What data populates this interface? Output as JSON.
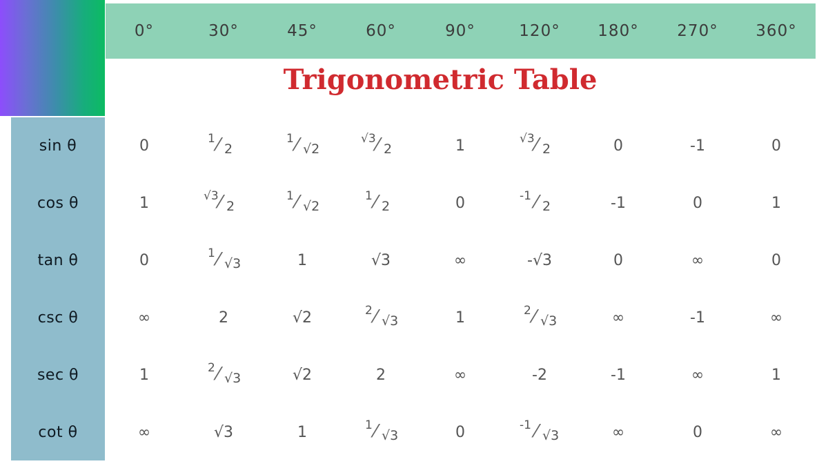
{
  "title": "Trigonometric Table",
  "colors": {
    "header_band": "#8ed2b6",
    "row_label_band": "#8fbccc",
    "title": "#d02a2f",
    "corner_gradient": [
      "#8d4dfc",
      "#0cbb62"
    ]
  },
  "angles": [
    "0°",
    "30°",
    "45°",
    "60°",
    "90°",
    "120°",
    "180°",
    "270°",
    "360°"
  ],
  "rows": [
    {
      "label": "sin θ",
      "values": [
        {
          "text": "0"
        },
        {
          "num": "1",
          "den": "2"
        },
        {
          "num": "1",
          "den": "√2"
        },
        {
          "num": "√3",
          "den": "2"
        },
        {
          "text": "1"
        },
        {
          "num": "√3",
          "den": "2"
        },
        {
          "text": "0"
        },
        {
          "text": "-1"
        },
        {
          "text": "0"
        }
      ]
    },
    {
      "label": "cos θ",
      "values": [
        {
          "text": "1"
        },
        {
          "num": "√3",
          "den": "2"
        },
        {
          "num": "1",
          "den": "√2"
        },
        {
          "num": "1",
          "den": "2"
        },
        {
          "text": "0"
        },
        {
          "num": "-1",
          "den": "2"
        },
        {
          "text": "-1"
        },
        {
          "text": "0"
        },
        {
          "text": "1"
        }
      ]
    },
    {
      "label": "tan θ",
      "values": [
        {
          "text": "0"
        },
        {
          "num": "1",
          "den": "√3"
        },
        {
          "text": "1"
        },
        {
          "text": "√3"
        },
        {
          "text": "∞"
        },
        {
          "text": "-√3"
        },
        {
          "text": "0"
        },
        {
          "text": "∞"
        },
        {
          "text": "0"
        }
      ]
    },
    {
      "label": "csc θ",
      "values": [
        {
          "text": "∞"
        },
        {
          "text": "2"
        },
        {
          "text": "√2"
        },
        {
          "num": "2",
          "den": "√3"
        },
        {
          "text": "1"
        },
        {
          "num": "2",
          "den": "√3"
        },
        {
          "text": "∞"
        },
        {
          "text": "-1"
        },
        {
          "text": "∞"
        }
      ]
    },
    {
      "label": "sec θ",
      "values": [
        {
          "text": "1"
        },
        {
          "num": "2",
          "den": "√3"
        },
        {
          "text": "√2"
        },
        {
          "text": "2"
        },
        {
          "text": "∞"
        },
        {
          "text": "-2"
        },
        {
          "text": "-1"
        },
        {
          "text": "∞"
        },
        {
          "text": "1"
        }
      ]
    },
    {
      "label": "cot θ",
      "values": [
        {
          "text": "∞"
        },
        {
          "text": "√3"
        },
        {
          "text": "1"
        },
        {
          "num": "1",
          "den": "√3"
        },
        {
          "text": "0"
        },
        {
          "num": "-1",
          "den": "√3"
        },
        {
          "text": "∞"
        },
        {
          "text": "0"
        },
        {
          "text": "∞"
        }
      ]
    }
  ]
}
